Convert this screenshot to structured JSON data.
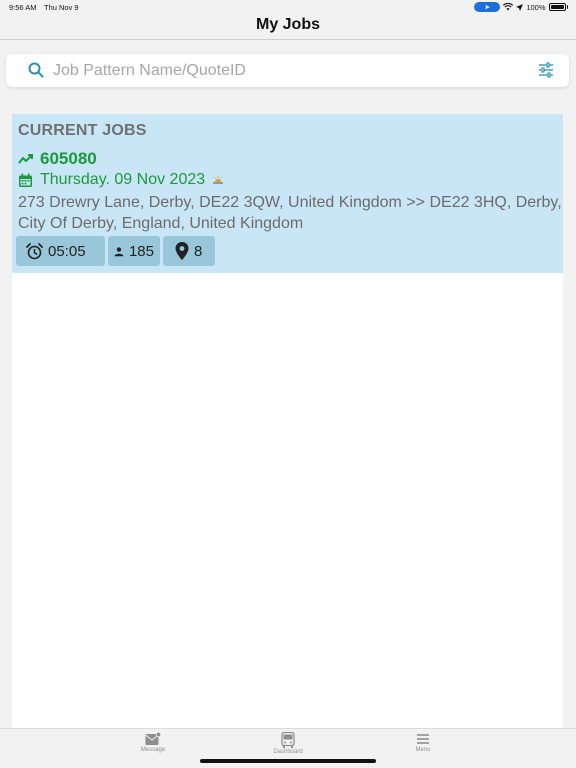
{
  "status_bar": {
    "time": "9:56 AM",
    "date": "Thu Nov 9",
    "battery": "100%"
  },
  "nav": {
    "title": "My Jobs"
  },
  "search": {
    "placeholder": "Job Pattern Name/QuoteID"
  },
  "jobs_section": {
    "title": "CURRENT JOBS",
    "jobs": [
      {
        "id": "605080",
        "date": "Thursday. 09 Nov 2023",
        "address": "273 Drewry Lane, Derby, DE22 3QW, United Kingdom >> DE22 3HQ, Derby, City Of Derby, England, United Kingdom",
        "time": "05:05",
        "passengers": "185",
        "stops": "8"
      }
    ]
  },
  "tabs": [
    {
      "label": "Message",
      "icon": "message-icon"
    },
    {
      "label": "Dashboard",
      "icon": "bus-icon"
    },
    {
      "label": "Menu",
      "icon": "menu-icon"
    }
  ],
  "colors": {
    "accent_green": "#1a9a3a",
    "card_bg": "#c9e6f7",
    "badge_bg": "#97c7d8",
    "search_icon": "#2a8fb8"
  }
}
